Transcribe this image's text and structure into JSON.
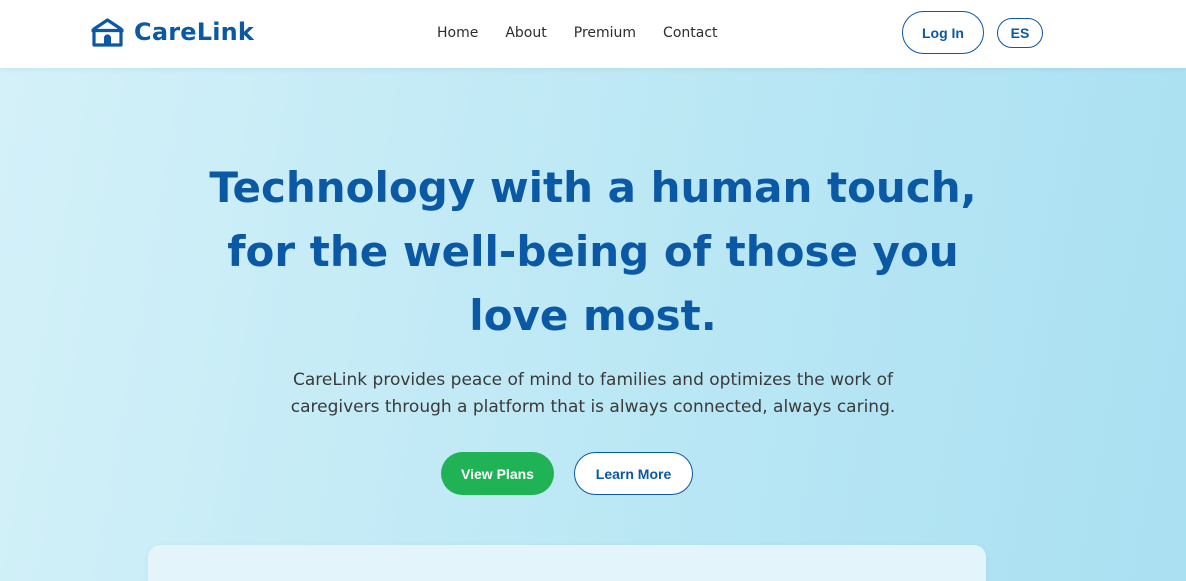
{
  "brand": {
    "name": "CareLink",
    "icon": "home-icon",
    "color": "#0b58a5"
  },
  "nav": {
    "items": [
      {
        "label": "Home"
      },
      {
        "label": "About"
      },
      {
        "label": "Premium"
      },
      {
        "label": "Contact"
      }
    ]
  },
  "header_actions": {
    "login_label": "Log In",
    "language_label": "ES"
  },
  "hero": {
    "title_line1": "Technology with a human touch,",
    "title_line2": "for the well-being of those you",
    "title_line3": "love most.",
    "subtitle_line1": "CareLink provides peace of mind to families and optimizes the work of",
    "subtitle_line2": "caregivers through a platform that is always connected, always caring.",
    "primary_button": "View Plans",
    "secondary_button": "Learn More"
  },
  "colors": {
    "accent": "#0b58a5",
    "primary_button_bg": "#1fb356",
    "hero_bg_start": "#d4f1f9",
    "hero_bg_end": "#a9e0f2"
  }
}
